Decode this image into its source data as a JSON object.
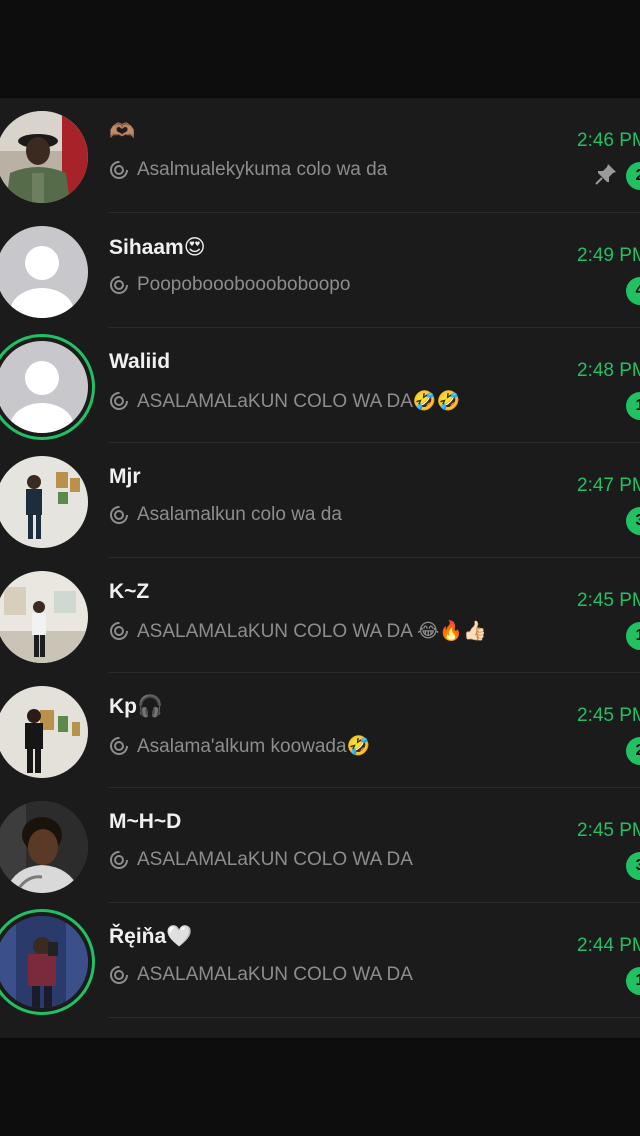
{
  "colors": {
    "accent": "#21c063",
    "background": "#1b1b1b",
    "text_primary": "#f0f0f0",
    "text_secondary": "#8d8d8d"
  },
  "chats": [
    {
      "name": "🫶🏽",
      "preview": "Asalmualekykuma colo wa da",
      "time": "2:46 PM",
      "unread": "2",
      "pinned": true,
      "avatar": "photo-uniform",
      "status_ring": false
    },
    {
      "name": "Sihaam😍",
      "preview": "Poopoboooboooboboopo",
      "time": "2:49 PM",
      "unread": "4",
      "pinned": false,
      "avatar": "default-avatar",
      "status_ring": false
    },
    {
      "name": "Waliid",
      "preview": "ASALAMALaKUN COLO WA DA🤣🤣",
      "time": "2:48 PM",
      "unread": "1",
      "pinned": false,
      "avatar": "default-avatar",
      "status_ring": true
    },
    {
      "name": "Mjr",
      "preview": "Asalamalkun colo wa da",
      "time": "2:47 PM",
      "unread": "3",
      "pinned": false,
      "avatar": "photo-gallery",
      "status_ring": false
    },
    {
      "name": "K~Z",
      "preview": "ASALAMALaKUN COLO WA DA 😂🔥👍🏻",
      "time": "2:45 PM",
      "unread": "1",
      "pinned": false,
      "avatar": "photo-room",
      "status_ring": false
    },
    {
      "name": "Kp🎧",
      "preview": "Asalama'alkum koowada🤣",
      "time": "2:45 PM",
      "unread": "2",
      "pinned": false,
      "avatar": "photo-gallery",
      "status_ring": false
    },
    {
      "name": "M~H~D",
      "preview": "ASALAMALaKUN COLO WA DA",
      "time": "2:45 PM",
      "unread": "3",
      "pinned": false,
      "avatar": "photo-selfie",
      "status_ring": false
    },
    {
      "name": "Řęiňa🤍",
      "preview": "ASALAMALaKUN COLO WA DA",
      "time": "2:44 PM",
      "unread": "1",
      "pinned": false,
      "avatar": "photo-mirror",
      "status_ring": true
    }
  ]
}
